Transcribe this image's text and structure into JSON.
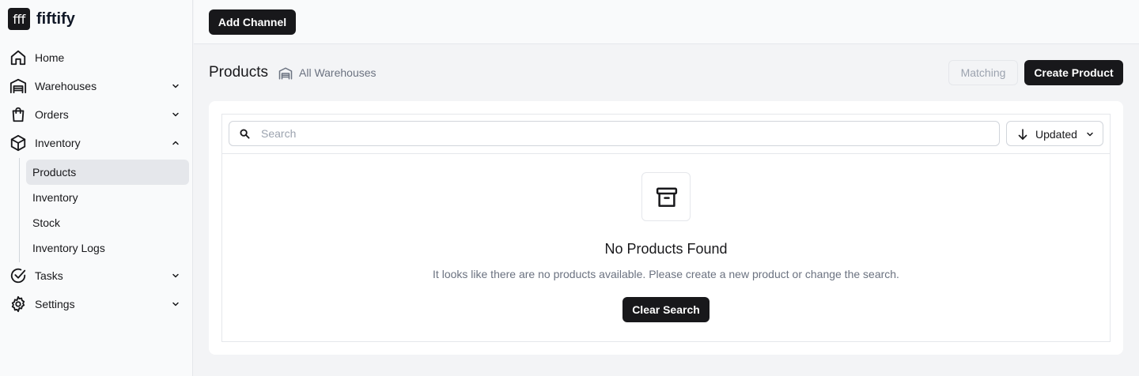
{
  "brand": {
    "logo_text": "fff",
    "name": "fiftify"
  },
  "sidebar": {
    "items": [
      {
        "label": "Home",
        "icon": "home-icon"
      },
      {
        "label": "Warehouses",
        "icon": "warehouse-icon",
        "expanded": false
      },
      {
        "label": "Orders",
        "icon": "shopping-bag-icon",
        "expanded": false
      },
      {
        "label": "Inventory",
        "icon": "box-icon",
        "expanded": true
      },
      {
        "label": "Tasks",
        "icon": "check-circle-icon",
        "expanded": false
      },
      {
        "label": "Settings",
        "icon": "gear-icon",
        "expanded": false
      }
    ],
    "inventory_subitems": [
      {
        "label": "Products",
        "active": true
      },
      {
        "label": "Inventory"
      },
      {
        "label": "Stock"
      },
      {
        "label": "Inventory Logs"
      }
    ]
  },
  "topbar": {
    "add_channel_label": "Add Channel"
  },
  "header": {
    "title": "Products",
    "warehouse_label": "All Warehouses",
    "matching_label": "Matching",
    "create_product_label": "Create Product"
  },
  "search": {
    "placeholder": "Search",
    "value": ""
  },
  "sort": {
    "label": "Updated",
    "direction": "descending"
  },
  "empty_state": {
    "icon": "archive-icon",
    "title": "No Products Found",
    "description": "It looks like there are no products available. Please create a new product or change the search.",
    "button_label": "Clear Search"
  },
  "colors": {
    "primary": "#18181b",
    "background": "#f3f4f6",
    "sidebar_bg": "#f9fafb",
    "muted_text": "#6b7280",
    "border": "#e5e7eb",
    "active_item_bg": "#e5e7eb"
  }
}
